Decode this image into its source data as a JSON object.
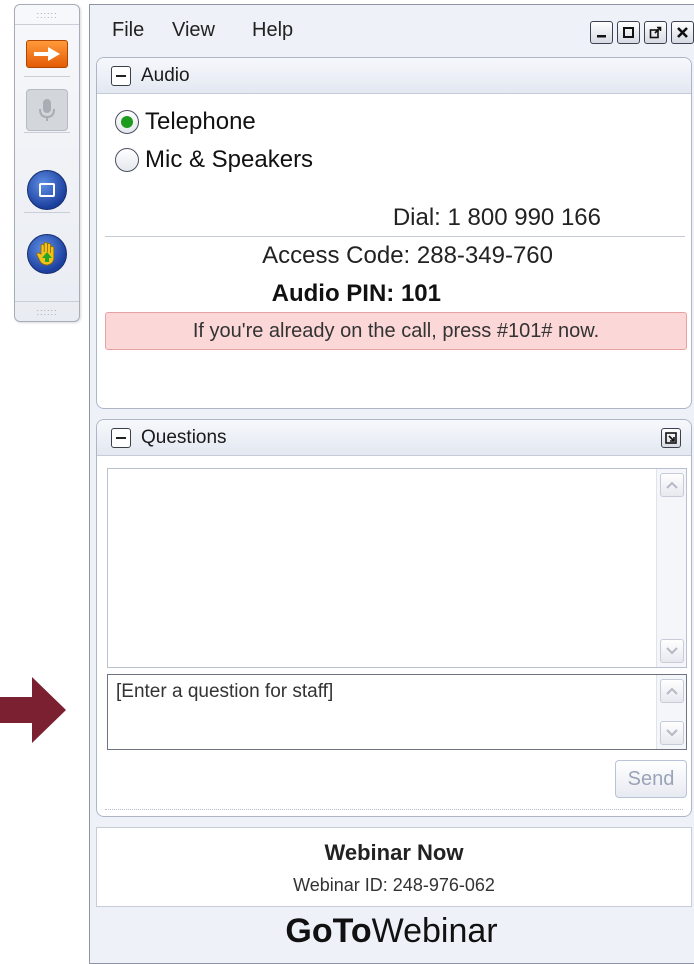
{
  "menubar": {
    "items": [
      "File",
      "View",
      "Help"
    ]
  },
  "window_controls": [
    "minimize-icon",
    "maximize-icon",
    "popout-icon",
    "close-icon"
  ],
  "toolbar": {
    "icons": [
      "show-hide-panel-icon",
      "microphone-icon",
      "screen-share-icon",
      "raise-hand-icon"
    ]
  },
  "audio": {
    "title": "Audio",
    "options": [
      {
        "label": "Telephone",
        "selected": true
      },
      {
        "label": "Mic & Speakers",
        "selected": false
      }
    ],
    "dial": "Dial: 1 800 990 166",
    "access_code": "Access Code: 288-349-760",
    "pin": "Audio PIN: 101",
    "notice": "If you're already on the call, press #101# now."
  },
  "questions": {
    "title": "Questions",
    "placeholder": "[Enter a question for staff]",
    "send_label": "Send"
  },
  "webinar": {
    "name": "Webinar Now",
    "id": "Webinar ID: 248-976-062"
  },
  "brand": {
    "bold": "GoTo",
    "light": "Webinar"
  },
  "colors": {
    "accent_orange": "#f07a1a",
    "notice_bg": "#fbd7d7",
    "arrow": "#7a2030",
    "radio_selected": "#1c9b1c"
  }
}
